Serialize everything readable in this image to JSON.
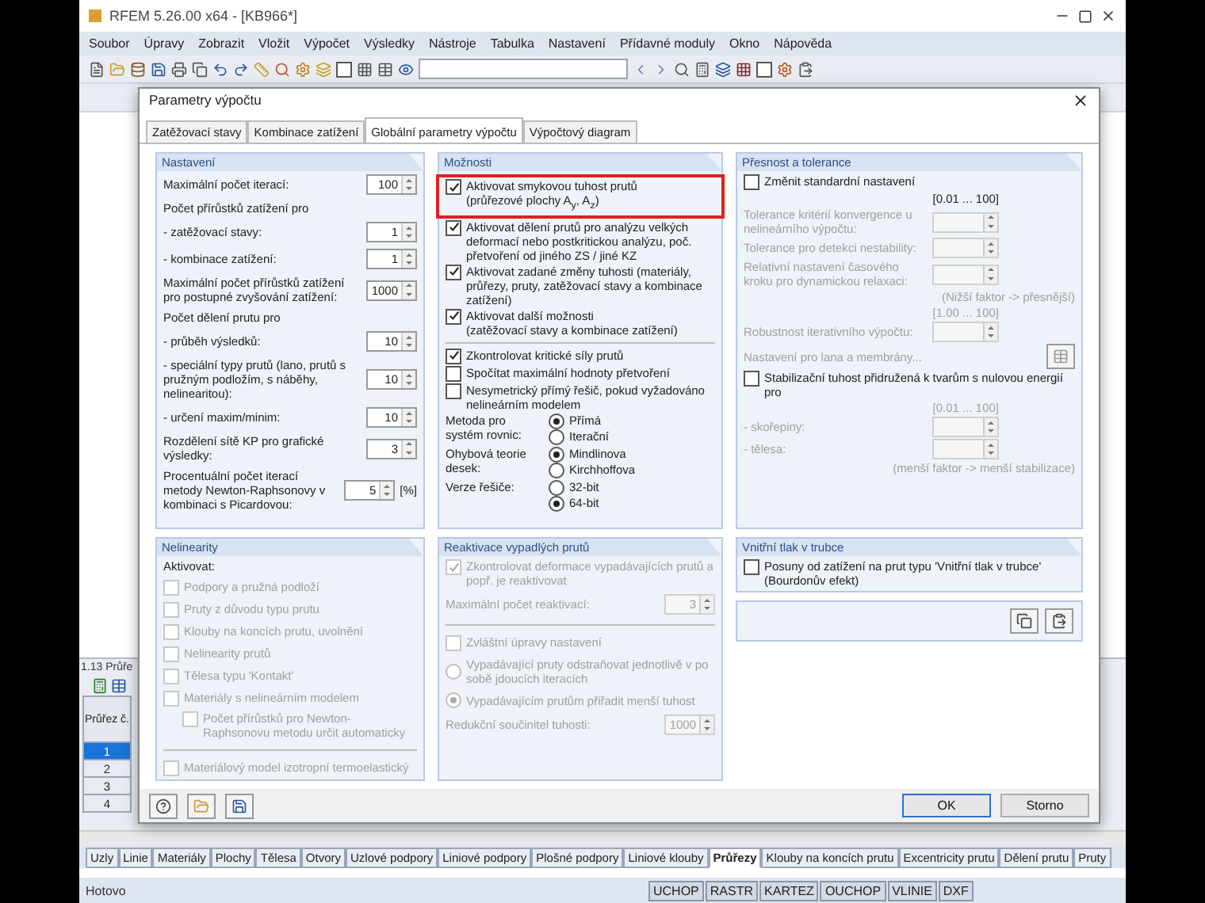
{
  "app": {
    "title": "RFEM 5.26.00 x64 - [KB966*]",
    "menu": [
      "Soubor",
      "Úpravy",
      "Zobrazit",
      "Vložit",
      "Výpočet",
      "Výsledky",
      "Nástroje",
      "Tabulka",
      "Nastavení",
      "Přídavné moduly",
      "Okno",
      "Nápověda"
    ],
    "bottom_tabs": [
      {
        "label": "Uzly",
        "selected": false
      },
      {
        "label": "Linie",
        "selected": false
      },
      {
        "label": "Materiály",
        "selected": false
      },
      {
        "label": "Plochy",
        "selected": false
      },
      {
        "label": "Tělesa",
        "selected": false
      },
      {
        "label": "Otvory",
        "selected": false
      },
      {
        "label": "Uzlové podpory",
        "selected": false
      },
      {
        "label": "Liniové podpory",
        "selected": false
      },
      {
        "label": "Plošné podpory",
        "selected": false
      },
      {
        "label": "Liniové klouby",
        "selected": false
      },
      {
        "label": "Průřezy",
        "selected": true
      },
      {
        "label": "Klouby na koncích prutu",
        "selected": false
      },
      {
        "label": "Excentricity prutu",
        "selected": false
      },
      {
        "label": "Dělení prutu",
        "selected": false
      },
      {
        "label": "Pruty",
        "selected": false
      }
    ],
    "status": "Hotovo",
    "status_toggles": [
      "UCHOP",
      "RASTR",
      "KARTEZ",
      "OUCHOP",
      "VLINIE",
      "DXF"
    ]
  },
  "table_panel": {
    "title": "1.13 Průře",
    "column": "Průřez č.",
    "rows": [
      {
        "label": "1",
        "selected": true
      },
      {
        "label": "2",
        "selected": false
      },
      {
        "label": "3",
        "selected": false
      },
      {
        "label": "4",
        "selected": false
      }
    ]
  },
  "dialog": {
    "title": "Parametry výpočtu",
    "tabs": [
      {
        "label": "Zatěžovací stavy",
        "selected": false
      },
      {
        "label": "Kombinace zatížení",
        "selected": false
      },
      {
        "label": "Globální parametry výpočtu",
        "selected": true
      },
      {
        "label": "Výpočtový diagram",
        "selected": false
      }
    ],
    "sections": [
      {
        "title": "Nastavení",
        "items": [
          {
            "kind": "field",
            "label": "Maximální počet iterací:",
            "value": "100",
            "disabled": false
          },
          {
            "kind": "heading",
            "label": "Počet přírůstků zatížení pro"
          },
          {
            "kind": "field",
            "label": "- zatěžovací stavy:",
            "value": "1",
            "disabled": false
          },
          {
            "kind": "field",
            "label": "- kombinace zatížení:",
            "value": "1",
            "disabled": false
          },
          {
            "kind": "field",
            "label": "Maximální počet přírůstků zatížení pro postupné zvyšování zatížení:",
            "value": "1000",
            "disabled": false
          },
          {
            "kind": "heading",
            "label": "Počet dělení prutu pro"
          },
          {
            "kind": "field",
            "label": "- průběh výsledků:",
            "value": "10",
            "disabled": false
          },
          {
            "kind": "field",
            "label": "- speciální typy prutů (lano, prutů s pružným podložím, s náběhy, nelinearitou):",
            "value": "10",
            "disabled": false
          },
          {
            "kind": "field",
            "label": "- určení maxim/minim:",
            "value": "10",
            "disabled": false
          },
          {
            "kind": "field",
            "label": "Rozdělení sítě KP pro grafické výsledky:",
            "value": "3",
            "disabled": false
          },
          {
            "kind": "field",
            "label": "Procentuální počet iterací metody Newton-Raphsonovy v kombinaci s Picardovou:",
            "value": "5",
            "unit": "[%]",
            "disabled": false
          }
        ]
      },
      {
        "title": "Možnosti",
        "items": [
          {
            "kind": "checkbox",
            "label": "Aktivovat smykovou tuhost prutů\n(průřezové plochy A$_{y}$, A$_{z}$)",
            "checked": true,
            "disabled": false,
            "highlighted": true
          },
          {
            "kind": "checkbox",
            "label": "Aktivovat dělení prutů pro analýzu velkých deformací nebo postkritickou analýzu, poč. přetvoření od jiného ZS / jiné KZ",
            "checked": true,
            "disabled": false,
            "highlighted": false
          },
          {
            "kind": "checkbox",
            "label": "Aktivovat zadané změny tuhosti (materiály, průřezy, pruty, zatěžovací stavy a kombinace zatížení)",
            "checked": true,
            "disabled": false,
            "highlighted": false
          },
          {
            "kind": "checkbox",
            "label": "Aktivovat další možnosti\n(zatěžovací stavy a kombinace zatížení)",
            "checked": true,
            "disabled": false,
            "highlighted": false
          },
          {
            "kind": "divider"
          },
          {
            "kind": "checkbox",
            "label": "Zkontrolovat kritické síly prutů",
            "checked": true,
            "disabled": false,
            "highlighted": false
          },
          {
            "kind": "checkbox",
            "label": "Spočítat maximální hodnoty přetvoření",
            "checked": false,
            "disabled": false,
            "highlighted": false
          },
          {
            "kind": "checkbox",
            "label": "Nesymetrický přímý řešič, pokud vyžadováno nelineárním modelem",
            "checked": false,
            "disabled": false,
            "highlighted": false
          },
          {
            "kind": "radio_group",
            "label": "Metoda pro systém rovnic:",
            "options": [
              {
                "label": "Přímá",
                "selected": true
              },
              {
                "label": "Iterační",
                "selected": false
              }
            ]
          },
          {
            "kind": "radio_group",
            "label": "Ohybová teorie desek:",
            "options": [
              {
                "label": "Mindlinova",
                "selected": true
              },
              {
                "label": "Kirchhoffova",
                "selected": false
              }
            ]
          },
          {
            "kind": "radio_group",
            "label": "Verze řešiče:",
            "options": [
              {
                "label": "32-bit",
                "selected": false
              },
              {
                "label": "64-bit",
                "selected": true
              }
            ]
          }
        ]
      },
      {
        "title": "Přesnost a tolerance",
        "items": [
          {
            "kind": "checkbox",
            "label": "Změnit standardní nastavení",
            "checked": false,
            "disabled": false,
            "highlighted": false
          },
          {
            "kind": "range",
            "label": "[0.01 ... 100]",
            "disabled": false
          },
          {
            "kind": "field",
            "label": "Tolerance kritérií konvergence u nelineárního výpočtu:",
            "disabled": true
          },
          {
            "kind": "field",
            "label": "Tolerance pro detekci nestability:",
            "disabled": true
          },
          {
            "kind": "field",
            "label": "Relativní nastavení časového kroku pro dynamickou relaxaci:",
            "disabled": true
          },
          {
            "kind": "note",
            "label": "(Nižší faktor -> přesnější)"
          },
          {
            "kind": "range",
            "label": "[1.00 ... 100]",
            "disabled": true
          },
          {
            "kind": "field",
            "label": "Robustnost iterativního výpočtu:",
            "disabled": true
          },
          {
            "kind": "link",
            "label": "Nastavení pro lana a membrány...",
            "disabled": true
          },
          {
            "kind": "checkbox",
            "label": "Stabilizační tuhost přidružená k tvarům s nulovou energií pro",
            "checked": false,
            "disabled": false,
            "highlighted": false
          },
          {
            "kind": "range",
            "label": "[0.01 ... 100]",
            "disabled": true
          },
          {
            "kind": "field",
            "label": "- skořepiny:",
            "disabled": true
          },
          {
            "kind": "field",
            "label": "- tělesa:",
            "disabled": true
          },
          {
            "kind": "note",
            "label": "(menší faktor -> menší stabilizace)"
          }
        ]
      },
      {
        "title": "Nelinearity",
        "items": [
          {
            "kind": "heading",
            "label": "Aktivovat:"
          },
          {
            "kind": "checkbox",
            "label": "Podpory a pružná podloží",
            "checked": false,
            "disabled": true,
            "highlighted": false
          },
          {
            "kind": "checkbox",
            "label": "Pruty z důvodu typu prutu",
            "checked": false,
            "disabled": true,
            "highlighted": false
          },
          {
            "kind": "checkbox",
            "label": "Klouby na koncích prutu, uvolnění",
            "checked": false,
            "disabled": true,
            "highlighted": false
          },
          {
            "kind": "checkbox",
            "label": "Nelinearity prutů",
            "checked": false,
            "disabled": true,
            "highlighted": false
          },
          {
            "kind": "checkbox",
            "label": "Tělesa typu 'Kontakt'",
            "checked": false,
            "disabled": true,
            "highlighted": false
          },
          {
            "kind": "checkbox",
            "label": "Materiály s nelineárním modelem",
            "checked": false,
            "disabled": true,
            "highlighted": false,
            "children": [
              {
                "kind": "checkbox",
                "label": "Počet přírůstků pro Newton-Raphsonovu metodu určit automaticky",
                "checked": false,
                "disabled": true,
                "highlighted": false
              }
            ]
          },
          {
            "kind": "divider"
          },
          {
            "kind": "checkbox",
            "label": "Materiálový model izotropní termoelastický",
            "checked": false,
            "disabled": true,
            "highlighted": false
          }
        ]
      },
      {
        "title": "Reaktivace vypadlých prutů",
        "items": [
          {
            "kind": "checkbox",
            "label": "Zkontrolovat deformace vypadávajících prutů a popř. je reaktivovat",
            "checked": true,
            "disabled": true,
            "highlighted": false
          },
          {
            "kind": "field",
            "label": "Maximální počet reaktivací:",
            "value": "3",
            "disabled": true
          },
          {
            "kind": "divider"
          },
          {
            "kind": "checkbox",
            "label": "Zvláštní úpravy nastavení",
            "checked": false,
            "disabled": true,
            "highlighted": false
          },
          {
            "kind": "radio",
            "label": "Vypadávající pruty odstraňovat jednotlivě v po sobě jdoucích iteracích",
            "selected": false,
            "disabled": true
          },
          {
            "kind": "radio",
            "label": "Vypadávajícím prutům přiřadit menší tuhost",
            "selected": true,
            "disabled": true
          },
          {
            "kind": "field",
            "label": "Redukční součinitel tuhosti:",
            "value": "1000",
            "disabled": true
          }
        ]
      },
      {
        "title": "Vnitřní tlak v trubce",
        "items": [
          {
            "kind": "checkbox",
            "label": "Posuny od zatížení na prut typu 'Vnitřní tlak v trubce' (Bourdonův efekt)",
            "checked": false,
            "disabled": false,
            "highlighted": false
          }
        ]
      }
    ],
    "buttons": [
      {
        "label": "OK",
        "default": true
      },
      {
        "label": "Storno",
        "default": false
      }
    ]
  }
}
